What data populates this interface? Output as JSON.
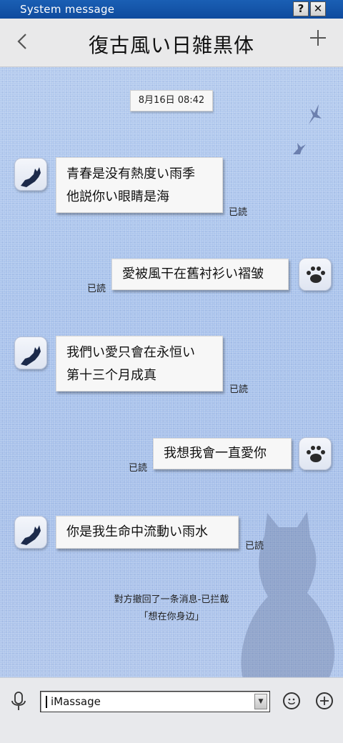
{
  "window": {
    "title": "System message",
    "help_label": "?",
    "close_label": "✕"
  },
  "header": {
    "back_icon": "chevron-left-icon",
    "title": "復古風い日雑黒体",
    "add_icon": "plus-icon"
  },
  "timestamp": "8月16日  08:42",
  "messages": [
    {
      "side": "left",
      "lines": [
        "青春是没有熱度い雨季",
        "他説你い眼睛是海"
      ],
      "read": "已読"
    },
    {
      "side": "right",
      "lines": [
        "愛被風干在舊衬衫い褶皱"
      ],
      "read": "已読"
    },
    {
      "side": "left",
      "lines": [
        "我們い愛只會在永恒い",
        "第十三个月成真"
      ],
      "read": "已読"
    },
    {
      "side": "right",
      "lines": [
        "我想我會一直愛你"
      ],
      "read": "已読"
    },
    {
      "side": "left",
      "lines": [
        "你是我生命中流動い雨水"
      ],
      "read": "已読"
    }
  ],
  "recall": {
    "line1": "對方撤回了一条消息-已拦截",
    "line2": "「想在你身边」"
  },
  "input": {
    "value": "iMassage"
  },
  "colors": {
    "titlebar": "#1a5fb4",
    "background": "#a9c3ec",
    "bubble": "#f7f7f7"
  }
}
